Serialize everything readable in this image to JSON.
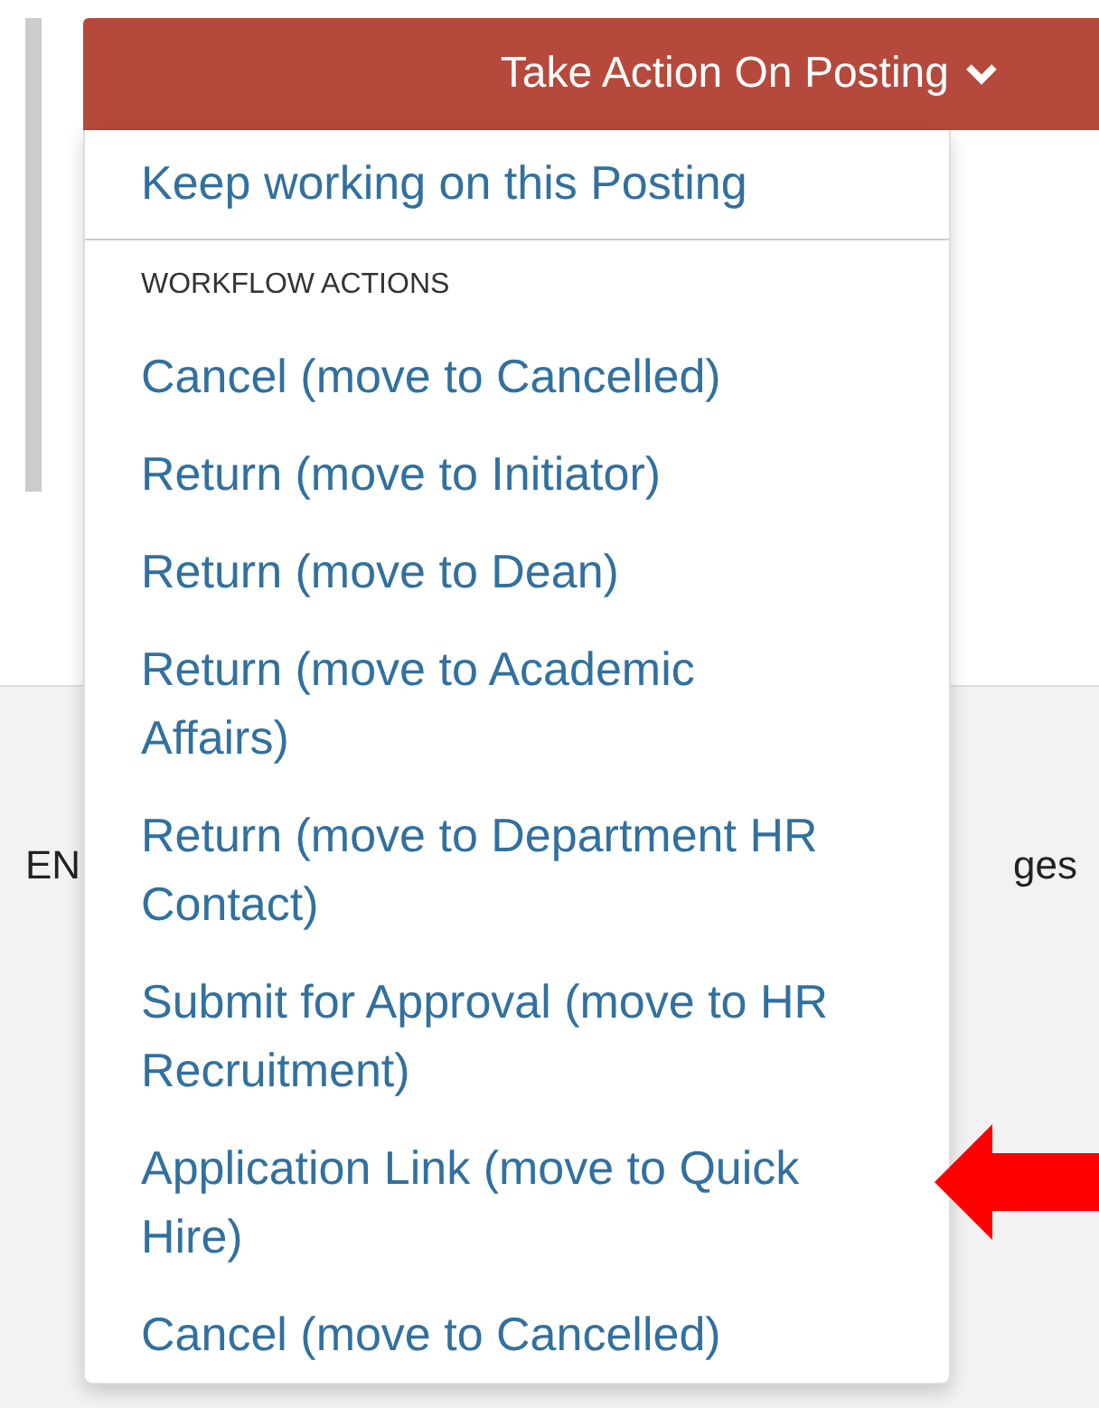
{
  "action_button": {
    "label": "Take Action On Posting"
  },
  "menu": {
    "items": [
      {
        "label": "Keep working on this Posting"
      }
    ],
    "section_header": "WORKFLOW ACTIONS",
    "workflow_actions": [
      {
        "label": "Cancel (move to Cancelled)"
      },
      {
        "label": "Return (move to Initiator)"
      },
      {
        "label": "Return (move to Dean)"
      },
      {
        "label": "Return (move to Academic Affairs)"
      },
      {
        "label": "Return (move to Department HR Contact)"
      },
      {
        "label": "Submit for Approval (move to HR Recruitment)"
      },
      {
        "label": "Application Link (move to Quick Hire)"
      },
      {
        "label": "Cancel (move to Cancelled)"
      }
    ]
  },
  "background_text": [
    "EN",
    "ges"
  ]
}
